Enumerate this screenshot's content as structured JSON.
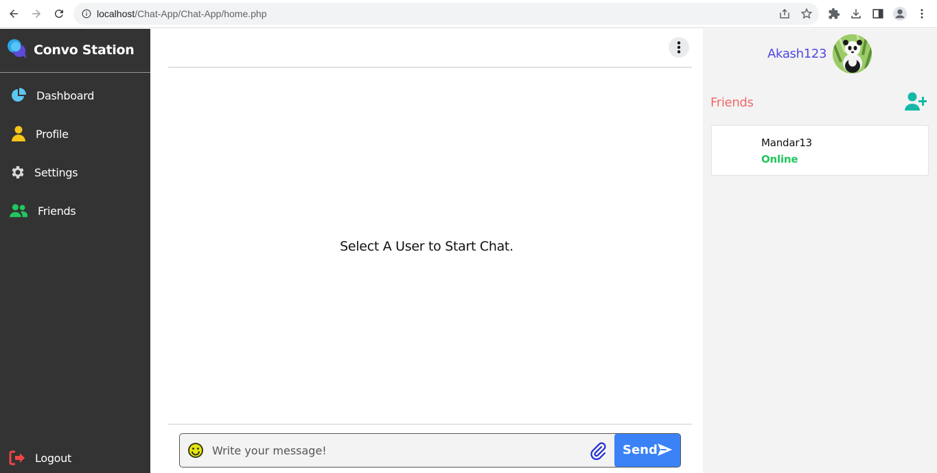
{
  "browser": {
    "url_host": "localhost",
    "url_path": "/Chat-App/Chat-App/home.php",
    "icons": [
      "back-icon",
      "forward-icon",
      "reload-icon",
      "info-icon",
      "share-icon",
      "star-icon",
      "extensions-icon",
      "download-icon",
      "side-panel-icon",
      "account-icon",
      "menu-icon"
    ]
  },
  "sidebar": {
    "brand": "Convo Station",
    "items": [
      {
        "label": "Dashboard",
        "icon": "pie-chart-icon",
        "color": "#5cc8f0"
      },
      {
        "label": "Profile",
        "icon": "user-icon",
        "color": "#f5c518"
      },
      {
        "label": "Settings",
        "icon": "gear-icon",
        "color": "#d9d9d9"
      },
      {
        "label": "Friends",
        "icon": "users-icon",
        "color": "#22c55e"
      }
    ],
    "logout": {
      "label": "Logout",
      "icon": "logout-icon",
      "color": "#ef4444"
    }
  },
  "chat": {
    "empty_message": "Select A User to Start Chat.",
    "input_placeholder": "Write your message!",
    "send_label": "Send"
  },
  "right_panel": {
    "username": "Akash123",
    "friends_title": "Friends",
    "friends": [
      {
        "name": "Mandar13",
        "status": "Online"
      }
    ]
  },
  "colors": {
    "sidebar_bg": "#333333",
    "accent": "#3b82f6",
    "username": "#4f46e5",
    "friends_title": "#f06a6a",
    "online": "#22c55e",
    "add_friend": "#14b8a6"
  }
}
